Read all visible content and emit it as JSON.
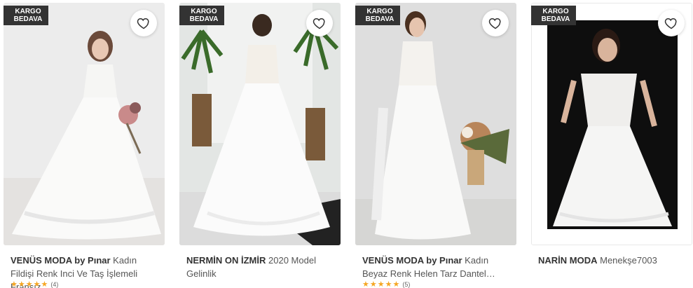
{
  "products": [
    {
      "badge": [
        "KARGO",
        "BEDAVA"
      ],
      "brand": "VENÜS MODA by Pınar",
      "name": "Kadın Fildişi Renk Inci Ve Taş İşlemeli Fransız…",
      "rating_stars": 5,
      "rating_count": "(4)",
      "background": "#ececec"
    },
    {
      "badge": [
        "KARGO",
        "BEDAVA"
      ],
      "brand": "NERMİN ON İZMİR",
      "name": "2020 Model Gelinlik",
      "rating_stars": 0,
      "rating_count": "",
      "background": "#e3e6e4"
    },
    {
      "badge": [
        "KARGO",
        "BEDAVA"
      ],
      "brand": "VENÜS MODA by Pınar",
      "name": "Kadın Beyaz Renk Helen Tarz Dantel…",
      "rating_stars": 5,
      "rating_count": "(5)",
      "background": "#dedede"
    },
    {
      "badge": [
        "KARGO",
        "BEDAVA"
      ],
      "brand": "NARİN MODA",
      "name": "Menekşe7003",
      "rating_stars": 0,
      "rating_count": "",
      "background": "#0e0e0e"
    }
  ],
  "icons": {
    "favorite": "heart-outline-icon",
    "rating": "star-icon"
  },
  "colors": {
    "badge_bg": "#333333",
    "star": "#f5a623",
    "text": "#333333"
  }
}
